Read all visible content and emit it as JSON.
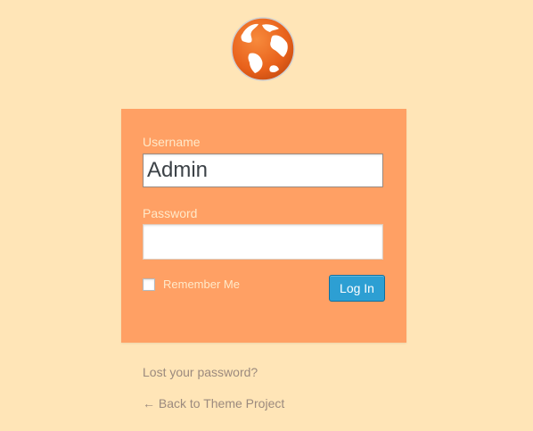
{
  "logo": {
    "icon": "globe-icon",
    "colors": {
      "ocean": "#ef6c22",
      "land": "#ffffff"
    }
  },
  "form": {
    "username_label": "Username",
    "username_value": "Admin",
    "password_label": "Password",
    "password_value": "",
    "remember_label": "Remember Me",
    "remember_checked": false,
    "submit_label": "Log In"
  },
  "links": {
    "lost_password": "Lost your password?",
    "back_to_site": "← Back to Theme Project"
  },
  "colors": {
    "page_background": "#ffe5b7",
    "box_background": "#ffa064",
    "button": "#2d9fd3"
  }
}
